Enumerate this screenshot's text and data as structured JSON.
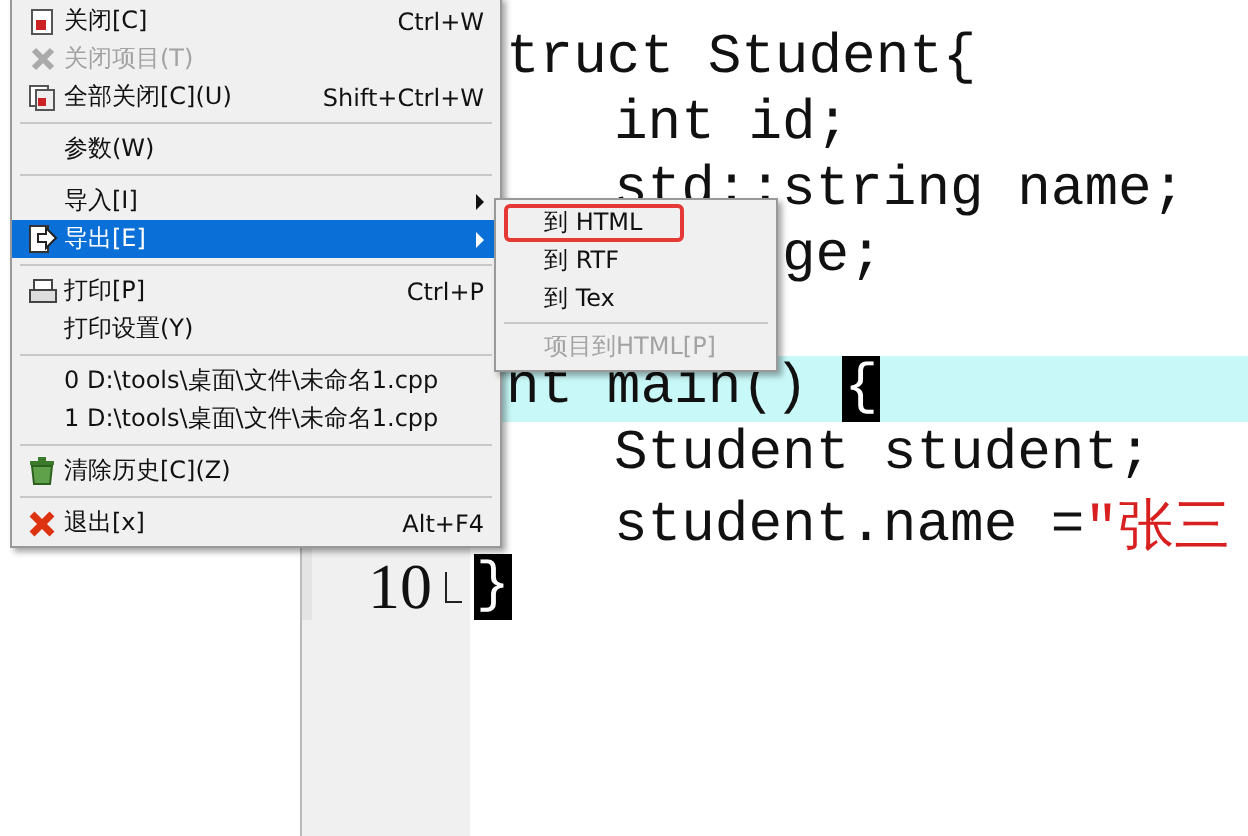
{
  "menu": {
    "items": [
      {
        "kind": "item",
        "label": "关闭[C]",
        "shortcut": "Ctrl+W",
        "disabled": false,
        "selected": false,
        "submenu": false
      },
      {
        "kind": "item",
        "label": "关闭项目(T)",
        "disabled": true,
        "selected": false,
        "submenu": false
      },
      {
        "kind": "item",
        "label": "全部关闭[C](U)",
        "shortcut": "Shift+Ctrl+W",
        "disabled": false,
        "selected": false,
        "submenu": false
      },
      {
        "kind": "separator"
      },
      {
        "kind": "item",
        "label": "参数(W)",
        "disabled": false,
        "selected": false,
        "submenu": false
      },
      {
        "kind": "separator"
      },
      {
        "kind": "item",
        "label": "导入[I]",
        "disabled": false,
        "selected": false,
        "submenu": true
      },
      {
        "kind": "item",
        "label": "导出[E]",
        "disabled": false,
        "selected": true,
        "submenu": true
      },
      {
        "kind": "separator"
      },
      {
        "kind": "item",
        "label": "打印[P]",
        "shortcut": "Ctrl+P",
        "disabled": false,
        "selected": false,
        "submenu": false
      },
      {
        "kind": "item",
        "label": "打印设置(Y)",
        "disabled": false,
        "selected": false,
        "submenu": false
      },
      {
        "kind": "separator"
      },
      {
        "kind": "item",
        "label": "0 D:\\tools\\桌面\\文件\\未命名1.cpp",
        "disabled": false,
        "selected": false,
        "submenu": false
      },
      {
        "kind": "item",
        "label": "1 D:\\tools\\桌面\\文件\\未命名1.cpp",
        "disabled": false,
        "selected": false,
        "submenu": false
      },
      {
        "kind": "separator"
      },
      {
        "kind": "item",
        "label": "清除历史[C](Z)",
        "disabled": false,
        "selected": false,
        "submenu": false
      },
      {
        "kind": "separator"
      },
      {
        "kind": "item",
        "label": "退出[x]",
        "shortcut": "Alt+F4",
        "disabled": false,
        "selected": false,
        "submenu": false
      }
    ]
  },
  "submenu": {
    "items": [
      {
        "kind": "item",
        "label": "到 HTML",
        "disabled": false,
        "highlighted": true
      },
      {
        "kind": "item",
        "label": "到 RTF",
        "disabled": false,
        "highlighted": false
      },
      {
        "kind": "item",
        "label": "到 Tex",
        "disabled": false,
        "highlighted": false
      },
      {
        "kind": "separator"
      },
      {
        "kind": "item",
        "label": "项目到HTML[P]",
        "disabled": true,
        "highlighted": false
      }
    ]
  },
  "editor": {
    "lines": [
      {
        "kind": "blank",
        "current": false
      },
      {
        "kind": "flush",
        "text": "truct Student{",
        "current": false
      },
      {
        "kind": "indent",
        "text": "int id;",
        "current": false
      },
      {
        "kind": "indent",
        "text": "std::string name;",
        "current": false
      },
      {
        "kind": "covered",
        "text": "ge;",
        "current": false
      },
      {
        "kind": "blank",
        "current": false
      },
      {
        "kind": "flush",
        "text": "nt main()",
        "bracket": "{",
        "current": true
      },
      {
        "kind": "indent",
        "text": "Student student;",
        "current": false
      },
      {
        "kind": "indent",
        "text": "student.name =",
        "string": "\"张三",
        "current": false
      },
      {
        "kind": "edge",
        "number": "10",
        "fold": true,
        "bracket": "}",
        "current": false
      }
    ]
  }
}
